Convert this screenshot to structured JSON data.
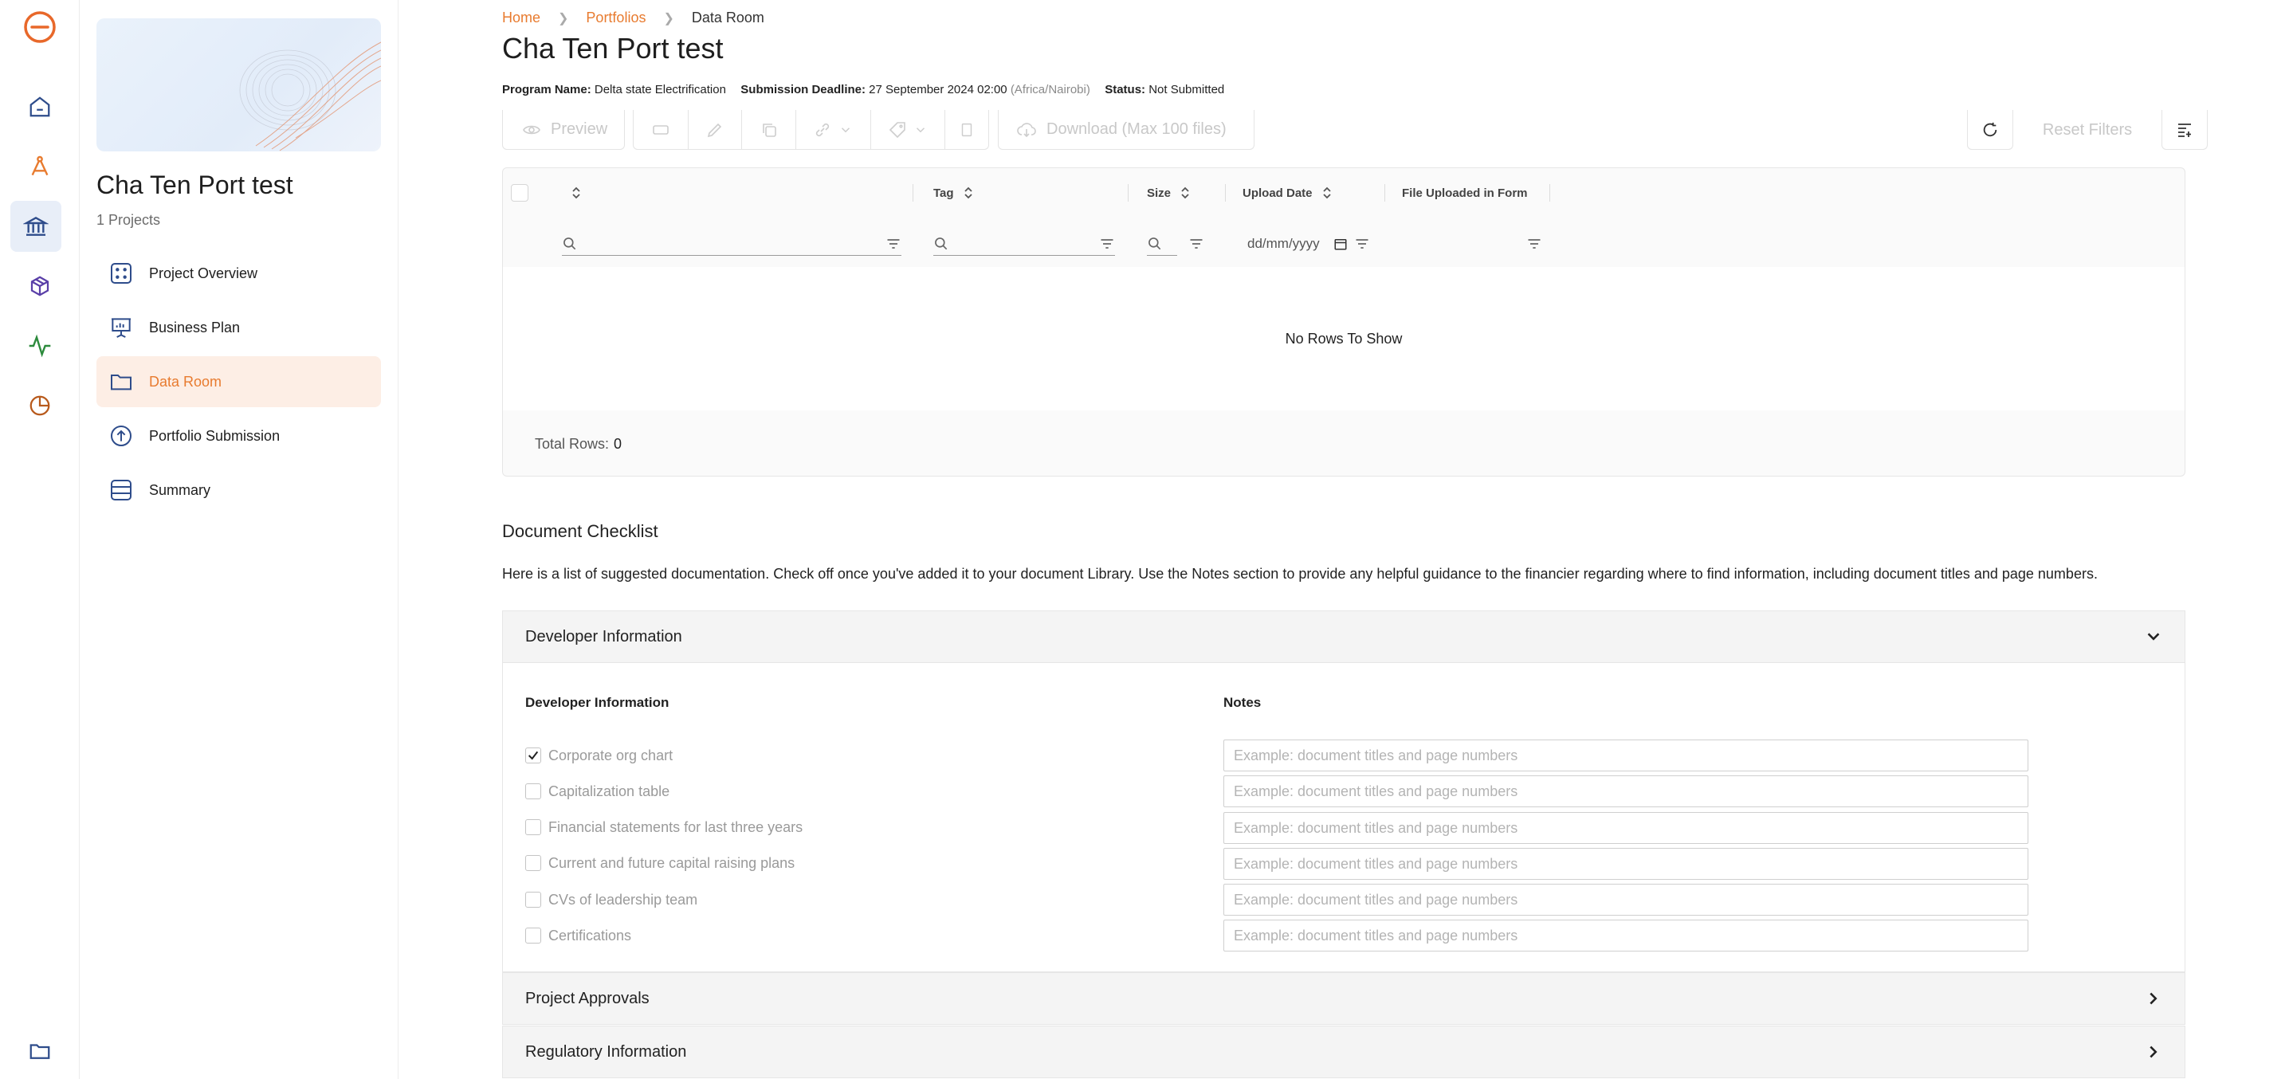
{
  "rail": {
    "icons": [
      "logo-icon",
      "home-icon",
      "compass-icon",
      "bank-icon",
      "package-icon",
      "activity-icon",
      "pie-chart-icon",
      "folder-icon"
    ]
  },
  "sidebar": {
    "project_title": "Cha Ten Port test",
    "project_count": "1 Projects",
    "items": [
      {
        "label": "Project Overview",
        "icon": "grid-dots-icon"
      },
      {
        "label": "Business Plan",
        "icon": "presentation-icon"
      },
      {
        "label": "Data Room",
        "icon": "folder-icon"
      },
      {
        "label": "Portfolio Submission",
        "icon": "upload-circle-icon"
      },
      {
        "label": "Summary",
        "icon": "list-box-icon"
      }
    ]
  },
  "breadcrumb": {
    "home": "Home",
    "portfolios": "Portfolios",
    "current": "Data Room"
  },
  "page": {
    "title": "Cha Ten Port test",
    "program_name_label": "Program Name:",
    "program_name": "Delta state Electrification",
    "deadline_label": "Submission Deadline:",
    "deadline": "27 September 2024 02:00",
    "timezone": "(Africa/Nairobi)",
    "status_label": "Status:",
    "status": "Not Submitted"
  },
  "toolbar": {
    "preview": "Preview",
    "download": "Download (Max 100 files)",
    "reset_filters": "Reset Filters"
  },
  "grid": {
    "columns": [
      "",
      "Tag",
      "Size",
      "Upload Date",
      "File Uploaded in Form"
    ],
    "date_placeholder": "dd/mm/yyyy",
    "empty": "No Rows To Show",
    "total_label": "Total Rows:",
    "total": "0"
  },
  "checklist": {
    "title": "Document Checklist",
    "description": "Here is a list of suggested documentation. Check off once you've added it to your document Library. Use the Notes section to provide any helpful guidance to the financier regarding where to find information, including document titles and page numbers.",
    "sections": [
      {
        "title": "Developer Information",
        "expanded": true
      },
      {
        "title": "Project Approvals",
        "expanded": false
      },
      {
        "title": "Regulatory Information",
        "expanded": false
      }
    ],
    "col_left": "Developer Information",
    "col_right": "Notes",
    "note_placeholder": "Example: document titles and page numbers",
    "items": [
      {
        "label": "Corporate org chart",
        "checked": true
      },
      {
        "label": "Capitalization table",
        "checked": false
      },
      {
        "label": "Financial statements for last three years",
        "checked": false
      },
      {
        "label": "Current and future capital raising plans",
        "checked": false
      },
      {
        "label": "CVs of leadership team",
        "checked": false
      },
      {
        "label": "Certifications",
        "checked": false
      }
    ]
  },
  "colors": {
    "accent": "#e87b2f",
    "rail_active": "#e8eef8",
    "nav_active_bg": "#fdeee5"
  }
}
